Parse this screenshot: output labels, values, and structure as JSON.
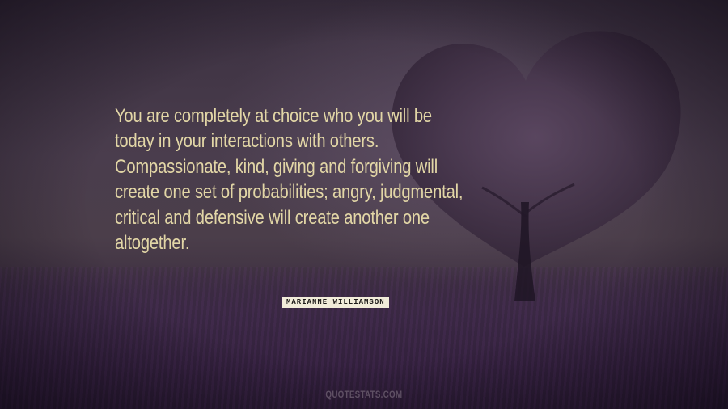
{
  "quote": {
    "lines": [
      "You are completely at choice who you will be",
      "today in your interactions with others.",
      "Compassionate, kind, giving and forgiving will",
      "create one set of probabilities; angry, judgmental,",
      "critical and defensive will create another one",
      "altogether."
    ]
  },
  "author": "MARIANNE WILLIAMSON",
  "footer": "QUOTESTATS.COM",
  "colors": {
    "quote_text": "#e2d6a6",
    "author_bg": "#f1ecd9",
    "footer_text": "#5f5064"
  }
}
